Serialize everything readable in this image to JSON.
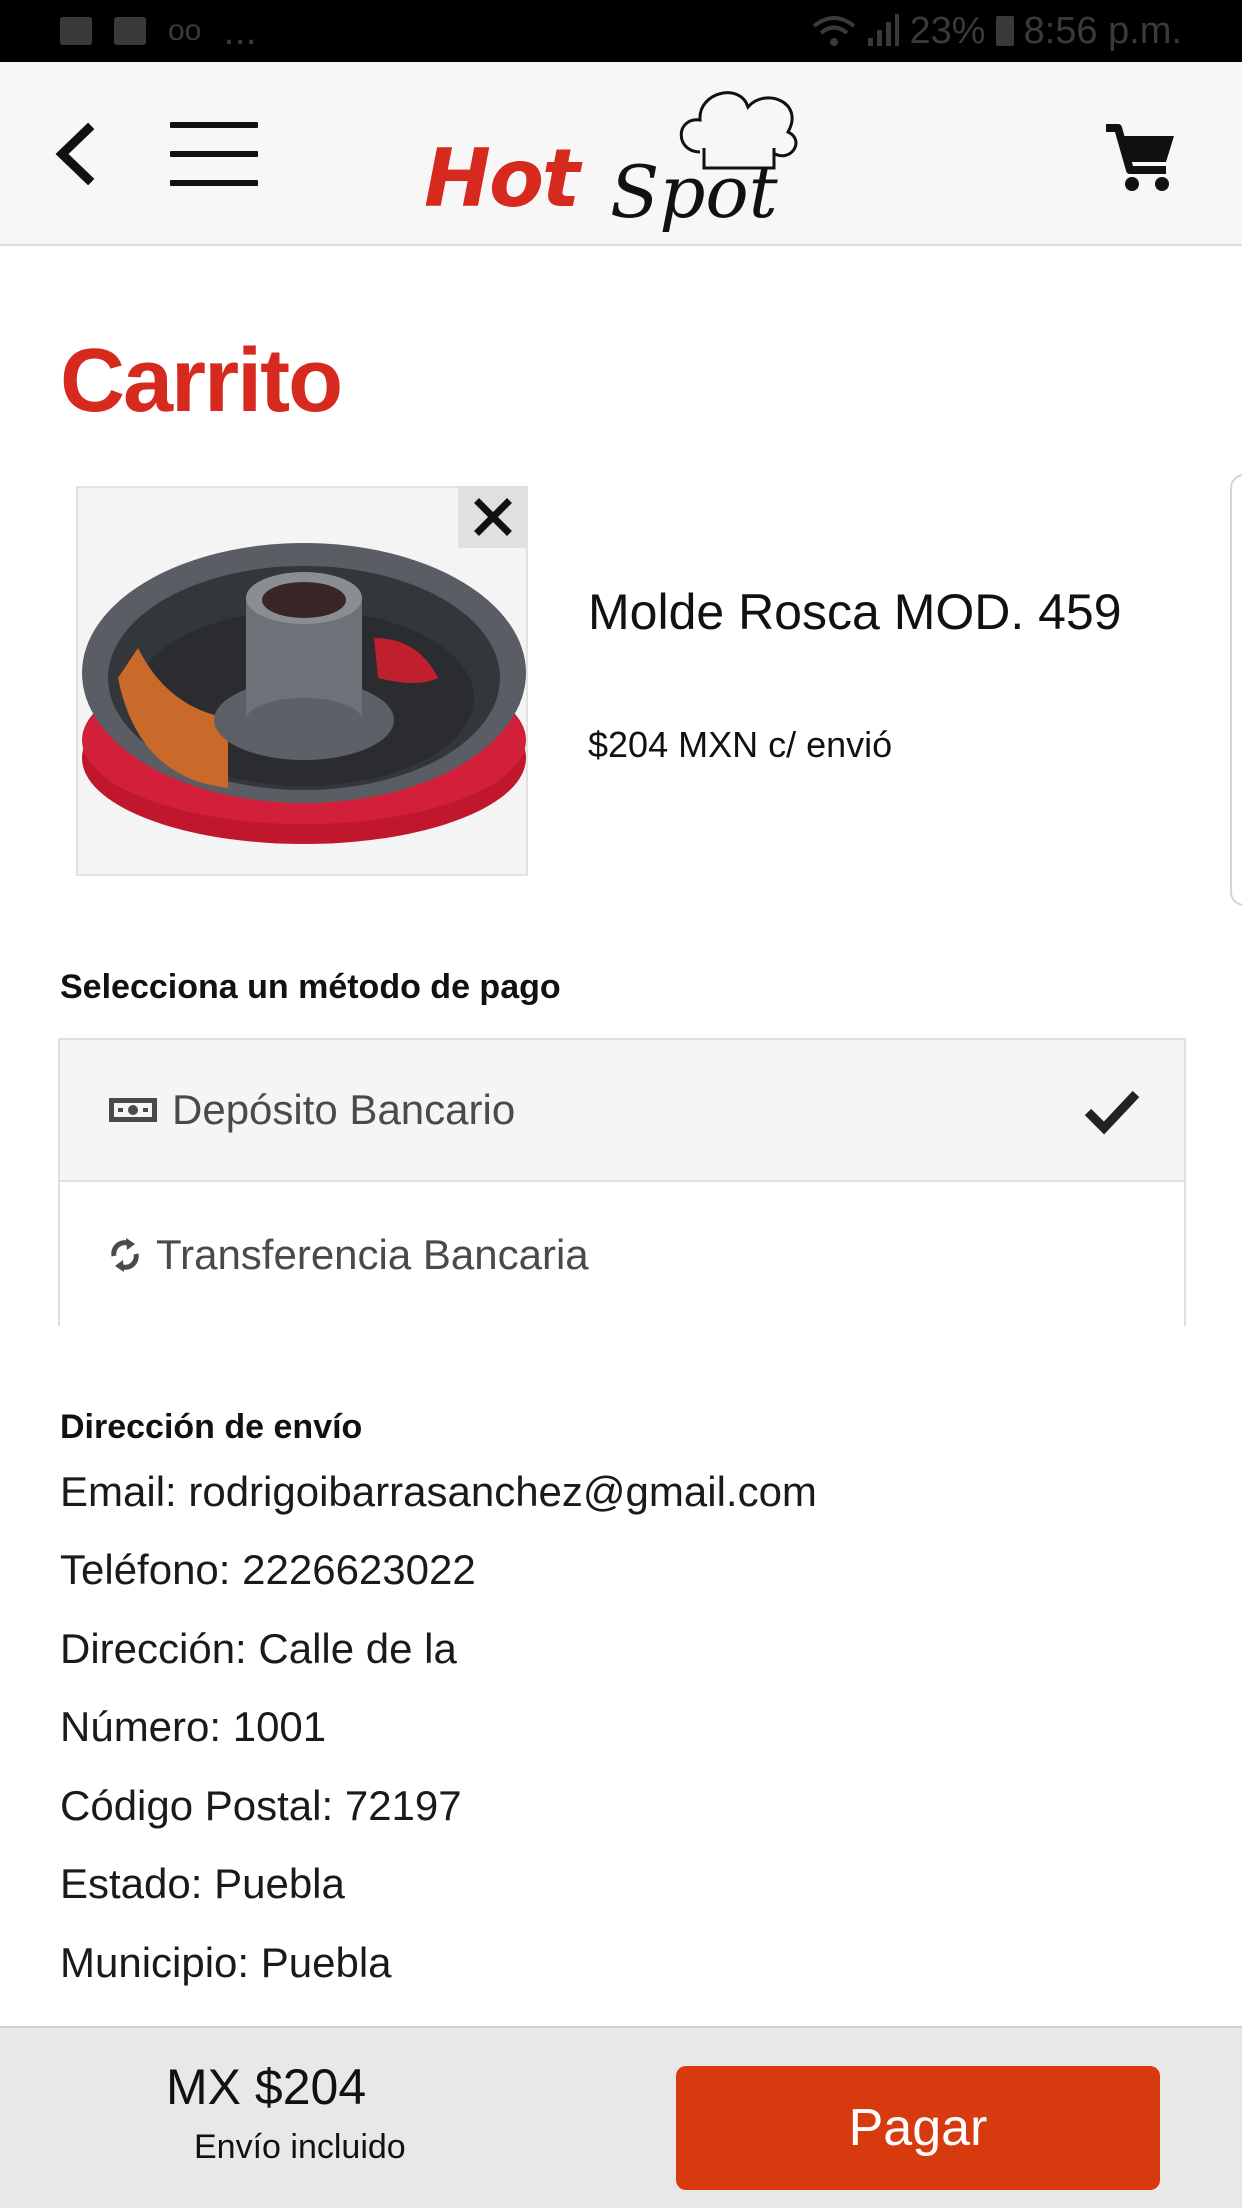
{
  "status_bar": {
    "dots": "...",
    "battery": "23%",
    "time": "8:56 p.m."
  },
  "header": {
    "logo_hot": "Hot",
    "logo_spot": "Spot",
    "back_icon": "chevron-left-icon",
    "menu_icon": "hamburger-menu-icon",
    "cart_icon": "shopping-cart-icon"
  },
  "page": {
    "title": "Carrito"
  },
  "cart": {
    "items": [
      {
        "name": "Molde Rosca MOD. 459",
        "price": "$204 MXN c/ envió",
        "remove_icon": "close-icon"
      }
    ]
  },
  "payment": {
    "label": "Selecciona un método de pago",
    "options": [
      {
        "label": "Depósito Bancario",
        "icon": "money-bill-icon",
        "selected": true
      },
      {
        "label": "Transferencia Bancaria",
        "icon": "sync-icon",
        "selected": false
      }
    ]
  },
  "shipping": {
    "label": "Dirección de envío",
    "lines": [
      "Email: rodrigoibarrasanchez@gmail.com",
      "Teléfono: 2226623022",
      "Dirección: Calle de la",
      "Número: 1001",
      "Código Postal: 72197",
      "Estado: Puebla",
      "Municipio: Puebla"
    ]
  },
  "footer": {
    "total": "MX $204",
    "note": "Envío incluido",
    "pay_button": "Pagar"
  },
  "colors": {
    "brand_red": "#d62a1e",
    "button_orange": "#d83a10"
  }
}
